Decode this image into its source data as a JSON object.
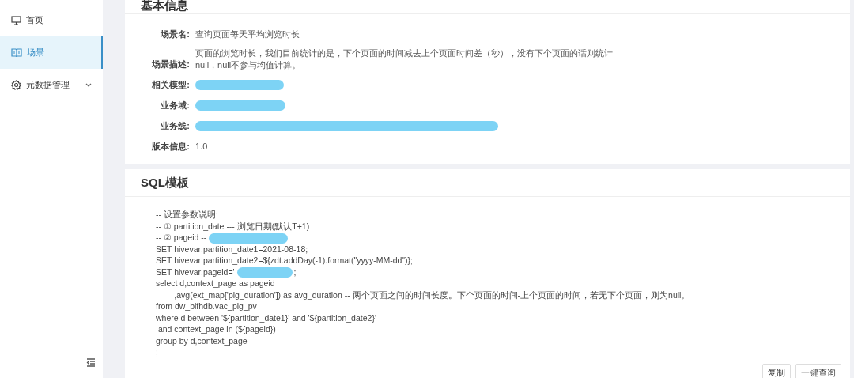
{
  "sidebar": {
    "items": [
      {
        "label": "首页",
        "kind": "monitor",
        "selected": false,
        "expandable": false
      },
      {
        "label": "场景",
        "kind": "book",
        "selected": true,
        "expandable": false
      },
      {
        "label": "元数据管理",
        "kind": "gear",
        "selected": false,
        "expandable": true
      }
    ]
  },
  "basic_info": {
    "title": "基本信息",
    "fields": [
      {
        "label": "场景名:",
        "kind": "text",
        "value": "查询页面每天平均浏览时长"
      },
      {
        "label": "场景描述:",
        "kind": "text",
        "value": "页面的浏览时长，我们目前统计的是，下个页面的时间减去上个页面时间差（秒），没有下个页面的话则统计null，null不参与均值计算。"
      },
      {
        "label": "相关模型:",
        "kind": "redacted"
      },
      {
        "label": "业务域:",
        "kind": "redacted"
      },
      {
        "label": "业务线:",
        "kind": "redacted"
      },
      {
        "label": "版本信息:",
        "kind": "text",
        "value": "1.0"
      }
    ]
  },
  "sql_template": {
    "title": "SQL模板",
    "lines": [
      [
        {
          "kind": "text",
          "text": "-- 设置参数说明:"
        }
      ],
      [
        {
          "kind": "text",
          "text": "-- ① partition_date --- 浏览日期(默认T+1)"
        }
      ],
      [
        {
          "kind": "text",
          "text": "-- ② pageid --"
        },
        {
          "kind": "redacted"
        }
      ],
      [
        {
          "kind": "text",
          "text": "SET hivevar:partition_date1=2021-08-18;"
        }
      ],
      [
        {
          "kind": "text",
          "text": "SET hivevar:partition_date2=${zdt.addDay(-1).format(\"yyyy-MM-dd\")};"
        }
      ],
      [
        {
          "kind": "text",
          "text": "SET hivevar:pageid='"
        },
        {
          "kind": "redacted"
        },
        {
          "kind": "text",
          "text": "';"
        }
      ],
      [
        {
          "kind": "text",
          "text": "select d,context_page as pageid"
        }
      ],
      [
        {
          "kind": "text",
          "text": "        ,avg(ext_map['pig_duration']) as avg_duration -- 两个页面之间的时间长度。下个页面的时间-上个页面的时间，若无下个页面，则为null。"
        }
      ],
      [
        {
          "kind": "text",
          "text": "from dw_bifhdb.vac_pig_pv"
        }
      ],
      [
        {
          "kind": "text",
          "text": "where d between '${partition_date1}' and '${partition_date2}'"
        }
      ],
      [
        {
          "kind": "text",
          "text": " and context_page in (${pageid})"
        }
      ],
      [
        {
          "kind": "text",
          "text": "group by d,context_page"
        }
      ],
      [
        {
          "kind": "text",
          "text": ";"
        }
      ]
    ],
    "buttons": [
      "复制",
      "一键查询"
    ]
  }
}
